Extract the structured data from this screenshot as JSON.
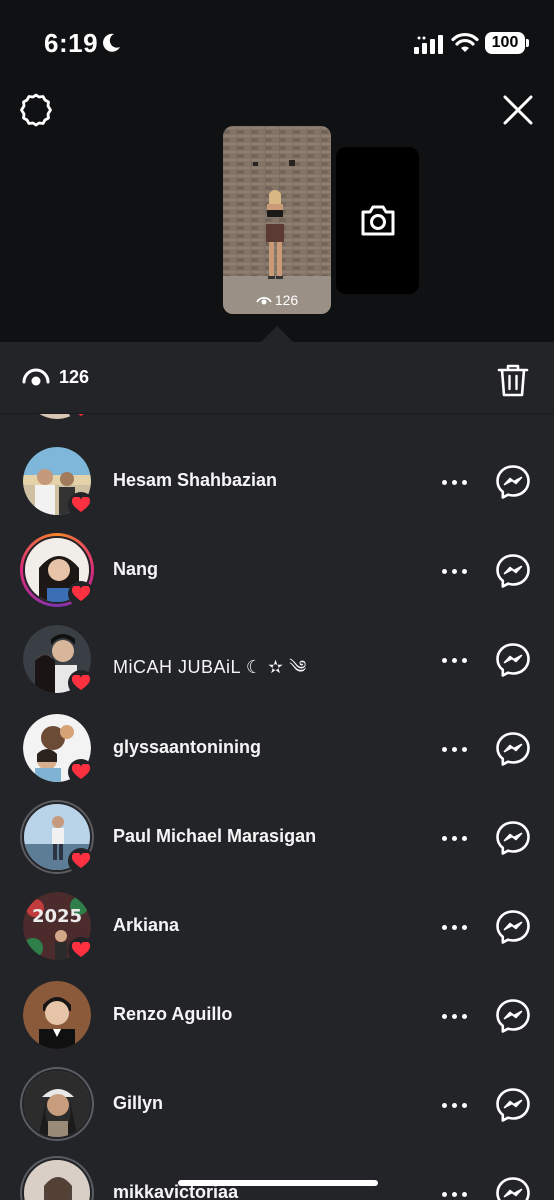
{
  "status_bar": {
    "time": "6:19",
    "battery": "100"
  },
  "story": {
    "view_count": "126"
  },
  "sheet": {
    "view_count": "126"
  },
  "viewers": [
    {
      "name": "Hesam Shahbazian",
      "liked": true
    },
    {
      "name": "Nang",
      "liked": true
    },
    {
      "name": "MiCAH JUBAiL ☾ ✫ ༄",
      "liked": true
    },
    {
      "name": "glyssaantonining",
      "liked": true
    },
    {
      "name": "Paul Michael Marasigan",
      "liked": true
    },
    {
      "name": "Arkiana",
      "liked": true
    },
    {
      "name": "Renzo Aguillo",
      "liked": false
    },
    {
      "name": "Gillyn",
      "liked": false
    },
    {
      "name": "mikkavictoriaa",
      "liked": false
    }
  ],
  "icons": {
    "heart": "heart-icon",
    "messenger": "messenger-icon",
    "more": "more-icon",
    "settings": "settings-icon",
    "close": "close-icon",
    "camera": "camera-icon",
    "eye": "eye-icon",
    "trash": "trash-icon"
  },
  "colors": {
    "heart": "#ff3040",
    "sheet_bg": "#232428",
    "header_bg": "#101113"
  }
}
